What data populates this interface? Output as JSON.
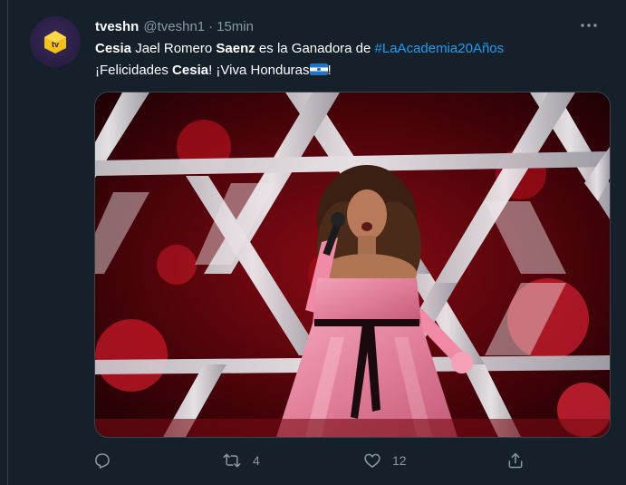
{
  "tweet": {
    "display_name": "tveshn",
    "handle": "@tveshn1",
    "separator": "·",
    "time": "15min",
    "more_label": "•••",
    "line1": {
      "b1": "Cesia",
      "t1": " Jael Romero ",
      "b2": "Saenz",
      "t2": " es la Ganadora de ",
      "hashtag": "#LaAcademia20Años"
    },
    "line2": {
      "t1": "¡Felicidades ",
      "b1": "Cesia",
      "t2": "! ¡Viva Honduras",
      "t3": "!"
    },
    "avatar_text": "tv",
    "stats": {
      "replies": "",
      "retweets": "4",
      "likes": "12"
    }
  },
  "colors": {
    "background": "#15202b",
    "secondary_text": "#8899a6",
    "link": "#1d9bf0",
    "avatar_bg": "#2b1f47",
    "avatar_logo": "#f2c21b"
  },
  "icons": {
    "reply": "reply-icon",
    "retweet": "retweet-icon",
    "like": "heart-icon",
    "share": "share-icon",
    "more": "more-icon",
    "flag": "honduras-flag-icon"
  }
}
